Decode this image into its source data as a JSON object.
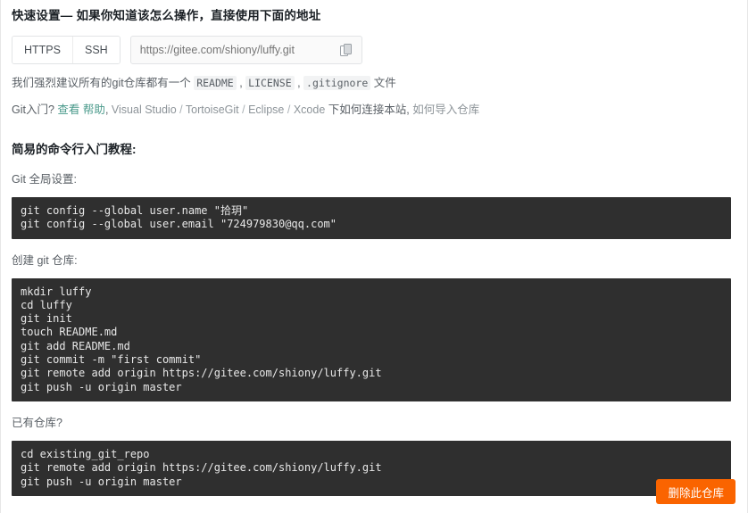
{
  "quick_setup": {
    "title": "快速设置— 如果你知道该怎么操作，直接使用下面的地址",
    "protocols": [
      {
        "label": "HTTPS",
        "active": true
      },
      {
        "label": "SSH",
        "active": false
      }
    ],
    "clone_url_value": "",
    "clone_url_placeholder": "https://gitee.com/shiony/luffy.git",
    "copy_icon": "clipboard-copy-icon"
  },
  "advice": {
    "prefix": "我们强烈建议所有的git仓库都有一个 ",
    "tags": [
      "README",
      "LICENSE",
      ".gitignore"
    ],
    "separator": " , ",
    "suffix": " 文件"
  },
  "getting_started": {
    "lead": "Git入门?",
    "view": "查看",
    "help": "帮助",
    "comma": ",",
    "ides": [
      "Visual Studio",
      "TortoiseGit",
      "Eclipse",
      "Xcode"
    ],
    "slash": "/",
    "connect_text": "下如何连接本站",
    "comma2": ",",
    "import_link": "如何导入仓库"
  },
  "tutorial": {
    "title": "简易的命令行入门教程:",
    "sections": [
      {
        "label": "Git 全局设置:",
        "code": "git config --global user.name \"拾玥\"\ngit config --global user.email \"724979830@qq.com\""
      },
      {
        "label": "创建 git 仓库:",
        "code": "mkdir luffy\ncd luffy\ngit init\ntouch README.md\ngit add README.md\ngit commit -m \"first commit\"\ngit remote add origin https://gitee.com/shiony/luffy.git\ngit push -u origin master"
      },
      {
        "label": "已有仓库?",
        "code": "cd existing_git_repo\ngit remote add origin https://gitee.com/shiony/luffy.git\ngit push -u origin master"
      }
    ]
  },
  "footer": {
    "delete_label": "删除此仓库",
    "delete_color": "#fa6400"
  }
}
